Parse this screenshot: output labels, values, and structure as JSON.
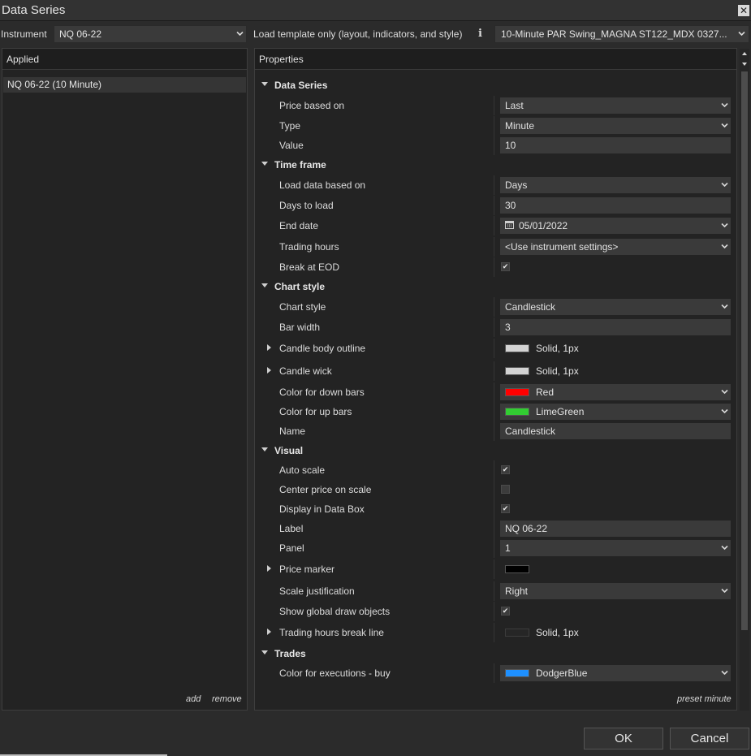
{
  "window": {
    "title": "Data Series",
    "close_glyph": "✕"
  },
  "instrument": {
    "label": "Instrument",
    "value": "NQ 06-22"
  },
  "template": {
    "label": "Load template only (layout, indicators, and style)",
    "info_glyph": "i",
    "value": "10-Minute PAR Swing_MAGNA ST122_MDX 0327..."
  },
  "applied": {
    "header": "Applied",
    "items": [
      "NQ 06-22 (10 Minute)"
    ],
    "add_label": "add",
    "remove_label": "remove"
  },
  "properties": {
    "header": "Properties",
    "preset_label": "preset minute",
    "categories": {
      "data_series": "Data Series",
      "time_frame": "Time frame",
      "chart_style": "Chart style",
      "visual": "Visual",
      "trades": "Trades"
    },
    "rows": {
      "price_based_on": {
        "name": "Price based on",
        "value": "Last"
      },
      "type": {
        "name": "Type",
        "value": "Minute"
      },
      "value": {
        "name": "Value",
        "value": "10"
      },
      "load_data_based_on": {
        "name": "Load data based on",
        "value": "Days"
      },
      "days_to_load": {
        "name": "Days to load",
        "value": "30"
      },
      "end_date": {
        "name": "End date",
        "value": "05/01/2022"
      },
      "trading_hours": {
        "name": "Trading hours",
        "value": "<Use instrument settings>"
      },
      "break_at_eod": {
        "name": "Break at EOD",
        "checked": true
      },
      "chart_style": {
        "name": "Chart style",
        "value": "Candlestick"
      },
      "bar_width": {
        "name": "Bar width",
        "value": "3"
      },
      "candle_body_outline": {
        "name": "Candle body outline",
        "value": "Solid, 1px",
        "color": "#d3d3d3"
      },
      "candle_wick": {
        "name": "Candle wick",
        "value": "Solid, 1px",
        "color": "#d3d3d3"
      },
      "color_down_bars": {
        "name": "Color for down bars",
        "value": "Red",
        "color": "#ff0000"
      },
      "color_up_bars": {
        "name": "Color for up bars",
        "value": "LimeGreen",
        "color": "#32cd32"
      },
      "name": {
        "name": "Name",
        "value": "Candlestick"
      },
      "auto_scale": {
        "name": "Auto scale",
        "checked": true
      },
      "center_price": {
        "name": "Center price on scale",
        "checked": false
      },
      "display_data_box": {
        "name": "Display in Data Box",
        "checked": true
      },
      "label": {
        "name": "Label",
        "value": "NQ 06-22"
      },
      "panel": {
        "name": "Panel",
        "value": "1"
      },
      "price_marker": {
        "name": "Price marker",
        "color": "#000000"
      },
      "scale_justification": {
        "name": "Scale justification",
        "value": "Right"
      },
      "show_global_draw": {
        "name": "Show global draw objects",
        "checked": true
      },
      "trading_hours_break": {
        "name": "Trading hours break line",
        "value": "Solid, 1px",
        "color": "#262626"
      },
      "color_executions_buy": {
        "name": "Color for executions - buy",
        "value": "DodgerBlue",
        "color": "#1e90ff"
      }
    }
  },
  "buttons": {
    "ok": "OK",
    "cancel": "Cancel"
  },
  "check_glyph": "✔"
}
